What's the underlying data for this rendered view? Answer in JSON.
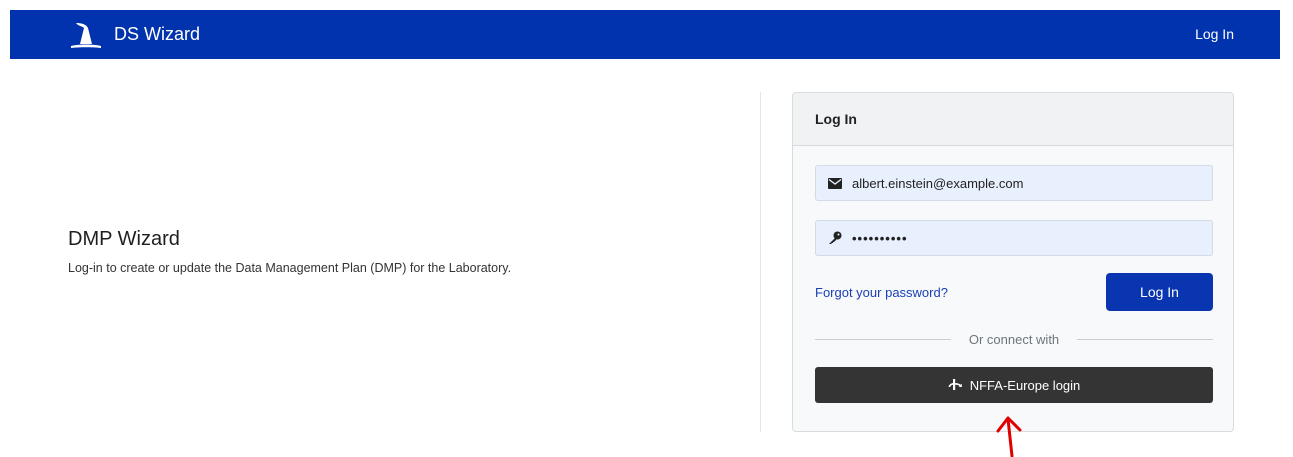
{
  "navbar": {
    "brand_name": "DS Wizard",
    "brand_icon": "wizard-hat-icon",
    "login_link": "Log In",
    "background_color": "#0033ad"
  },
  "intro": {
    "title": "DMP Wizard",
    "description": "Log-in to create or update the Data Management Plan (DMP) for the Laboratory."
  },
  "login_card": {
    "header": "Log In",
    "email": {
      "icon": "envelope-icon",
      "value": "albert.einstein@example.com"
    },
    "password": {
      "icon": "key-icon",
      "masked_value": "••••••••••"
    },
    "forgot_password": "Forgot your password?",
    "submit_label": "Log In",
    "divider_text": "Or connect with",
    "sso_button": {
      "icon": "openid-icon",
      "label": "NFFA-Europe login"
    }
  },
  "annotation": {
    "icon": "red-arrow-up-icon",
    "color": "#e00000"
  }
}
